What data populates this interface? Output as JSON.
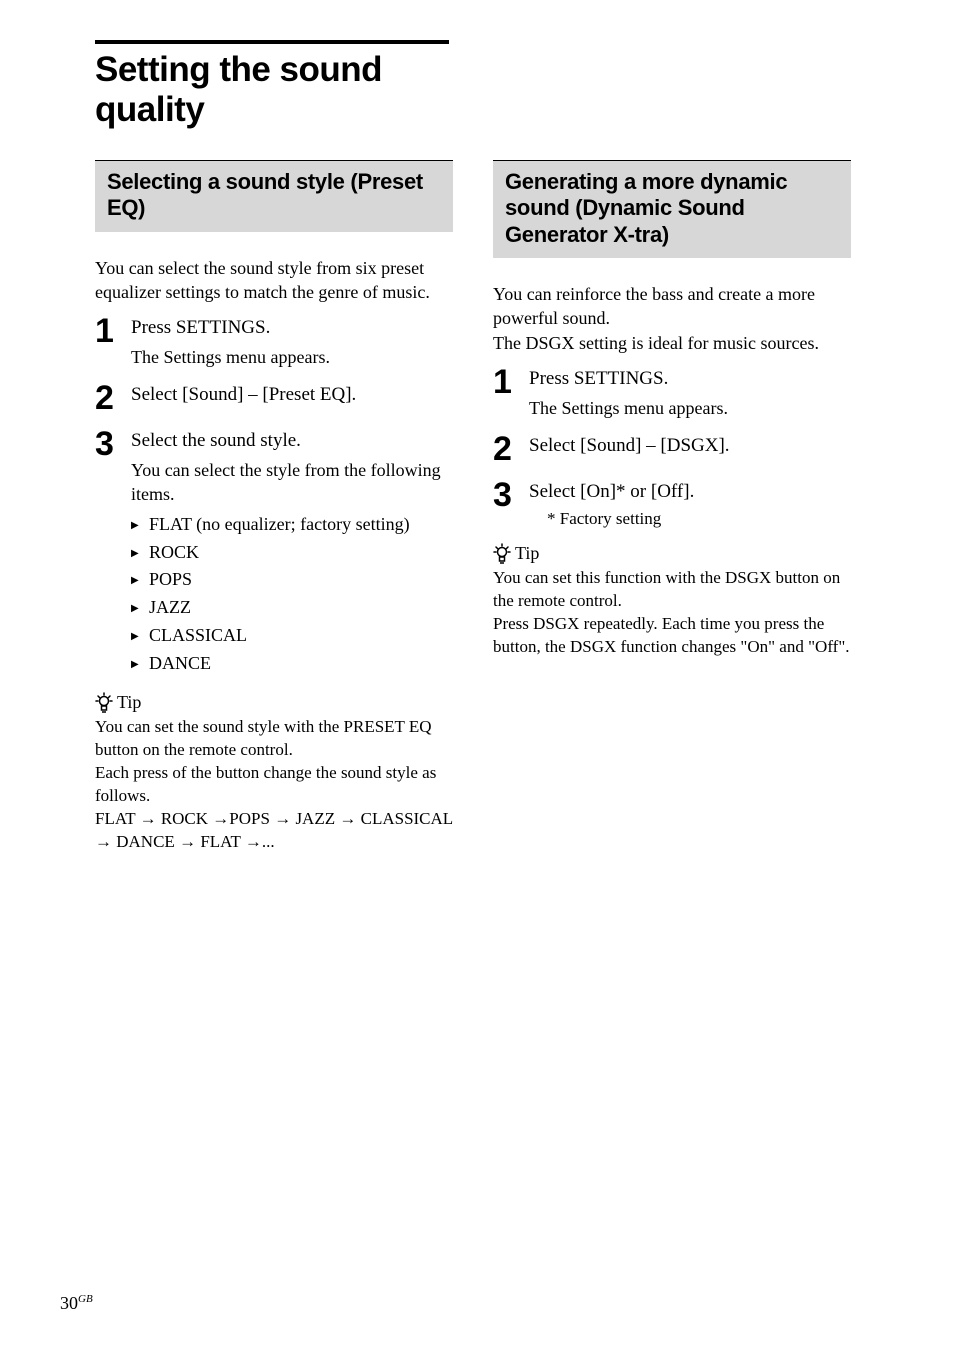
{
  "page_title": "Setting the sound quality",
  "left": {
    "section_title": "Selecting a sound style (Preset EQ)",
    "intro": "You can select the sound style from six preset equalizer settings to match the genre of music.",
    "steps": [
      {
        "num": "1",
        "main": "Press SETTINGS.",
        "sub": "The Settings menu appears."
      },
      {
        "num": "2",
        "main": "Select [Sound] – [Preset EQ]."
      },
      {
        "num": "3",
        "main": "Select the sound style.",
        "sub": "You can select the style from the following items.",
        "bullets": [
          "FLAT (no equalizer; factory setting)",
          "ROCK",
          "POPS",
          "JAZZ",
          "CLASSICAL",
          "DANCE"
        ]
      }
    ],
    "tip": {
      "label": "Tip",
      "body_1": "You can set the sound style with the PRESET EQ button on the remote control.",
      "body_2": "Each press of the button change the sound style as follows.",
      "sequence": [
        "FLAT",
        "ROCK",
        "POPS",
        "JAZZ",
        "CLASSICAL",
        "DANCE",
        "FLAT",
        "..."
      ]
    }
  },
  "right": {
    "section_title": "Generating a more dynamic sound (Dynamic Sound Generator X-tra)",
    "intro_1": "You can reinforce the bass and create a more powerful sound.",
    "intro_2": "The DSGX setting is ideal for music sources.",
    "steps": [
      {
        "num": "1",
        "main": "Press SETTINGS.",
        "sub": "The Settings menu appears."
      },
      {
        "num": "2",
        "main": "Select [Sound] – [DSGX]."
      },
      {
        "num": "3",
        "main": "Select [On]* or [Off].",
        "footnote": "*   Factory setting"
      }
    ],
    "tip": {
      "label": "Tip",
      "body_1": "You can set this function with the DSGX button on the remote control.",
      "body_2": "Press DSGX repeatedly. Each time you press the button, the DSGX function changes \"On\" and \"Off\"."
    }
  },
  "page_number": "30",
  "page_lang": "GB"
}
